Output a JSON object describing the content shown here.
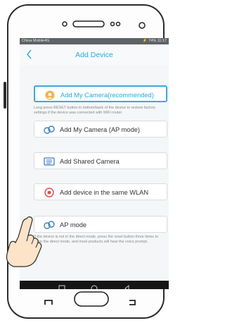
{
  "status_bar": {
    "carrier": "China Mobile4G",
    "right": "⚡ 74% 11:17"
  },
  "header": {
    "title": "Add Device"
  },
  "options": [
    {
      "label": "Add My Camera(recommended)",
      "icon": "camera-avatar-icon"
    },
    {
      "label": "Add My Camera (AP mode)",
      "icon": "link-icon"
    },
    {
      "label": "Add Shared Camera",
      "icon": "share-icon"
    },
    {
      "label": "Add device in the same WLAN",
      "icon": "location-pin-icon"
    },
    {
      "label": "AP mode",
      "icon": "link-icon"
    }
  ],
  "notes": {
    "reset": "Long press RESET button in bottom/back of the device to restore factory settings if the device was connected with WiFi router",
    "ap_mode": "If the device is not in the direct mode, press the reset button three times to enter the direct mode, and most products will hear the voice prompt."
  },
  "colors": {
    "accent": "#2aa8dc",
    "navbar": "#151515",
    "status_bar": "#5e6366"
  }
}
